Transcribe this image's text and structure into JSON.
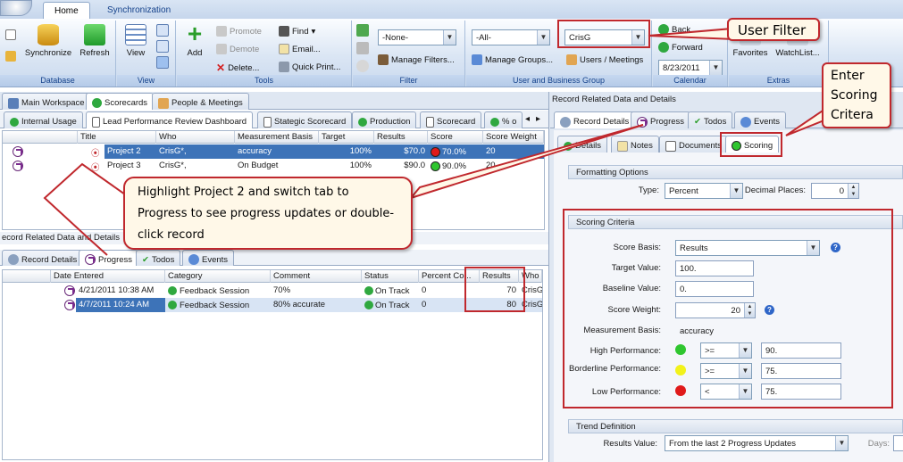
{
  "ribbon_tabs": [
    {
      "label": "Home"
    },
    {
      "label": "Synchronization"
    }
  ],
  "ribbon": {
    "database": {
      "label": "Database",
      "synchronize": "Synchronize",
      "refresh": "Refresh"
    },
    "view": {
      "label": "View",
      "view": "View"
    },
    "tools": {
      "label": "Tools",
      "add": "Add",
      "promote": "Promote",
      "demote": "Demote",
      "delete": "Delete...",
      "find": "Find",
      "email": "Email...",
      "quick_print": "Quick Print..."
    },
    "filter": {
      "label": "Filter",
      "combo": "-None-",
      "manage": "Manage Filters..."
    },
    "ubg": {
      "label": "User and Business Group",
      "combo": "-All-",
      "manage_groups": "Manage Groups...",
      "user_combo": "CrisG",
      "users_meetings": "Users / Meetings"
    },
    "calendar": {
      "label": "Calendar",
      "back": "Back",
      "forward": "Forward",
      "date": "8/23/2011"
    },
    "extras": {
      "label": "Extras",
      "favorites": "Favorites",
      "watchlist": "WatchList..."
    }
  },
  "workspace_tabs": [
    {
      "label": "Main Workspace"
    },
    {
      "label": "Scorecards"
    },
    {
      "label": "People & Meetings"
    }
  ],
  "scorecard_tabs": [
    {
      "label": "Internal Usage"
    },
    {
      "label": "Lead Performance Review Dashboard"
    },
    {
      "label": "Stategic Scorecard"
    },
    {
      "label": "Production"
    },
    {
      "label": "Scorecard"
    },
    {
      "label": "% o"
    }
  ],
  "scorecard_grid": {
    "headers": [
      "Title",
      "Who",
      "Measurement Basis",
      "Target",
      "Results",
      "Score",
      "Score Weight"
    ],
    "rows": [
      {
        "title": "Project 2",
        "who": "CrisG*,",
        "basis": "accuracy",
        "target": "100%",
        "results": "$70.0",
        "score": "70.0%",
        "weight": "20"
      },
      {
        "title": "Project 3",
        "who": "CrisG*,",
        "basis": "On Budget",
        "target": "100%",
        "results": "$90.0",
        "score": "90.0%",
        "weight": "20"
      }
    ]
  },
  "lower_panel_title": "ecord Related Data and Details",
  "lower_tabs": [
    {
      "label": "Record Details"
    },
    {
      "label": "Progress"
    },
    {
      "label": "Todos"
    },
    {
      "label": "Events"
    }
  ],
  "progress_grid": {
    "headers": [
      "Date Entered",
      "Category",
      "Comment",
      "Status",
      "Percent Co...",
      "Results",
      "Who Source"
    ],
    "rows": [
      {
        "date": "4/21/2011 10:38 AM",
        "category": "Feedback Session",
        "comment": "70%",
        "status": "On Track",
        "percent": "0",
        "results": "70",
        "who": "CrisG"
      },
      {
        "date": "4/7/2011 10:24 AM",
        "category": "Feedback Session",
        "comment": "80% accurate",
        "status": "On Track",
        "percent": "0",
        "results": "80",
        "who": "CrisG"
      }
    ]
  },
  "right_panel": {
    "title": "Record Related Data and Details",
    "tabs": [
      {
        "label": "Record Details"
      },
      {
        "label": "Progress"
      },
      {
        "label": "Todos"
      },
      {
        "label": "Events"
      }
    ],
    "subtabs": [
      {
        "label": "Details"
      },
      {
        "label": "Notes"
      },
      {
        "label": "Documents"
      },
      {
        "label": "Scoring"
      }
    ],
    "formatting": {
      "title": "Formatting Options",
      "type_label": "Type:",
      "type_value": "Percent",
      "decimal_label": "Decimal Places:",
      "decimal_value": "0"
    },
    "scoring": {
      "title": "Scoring Criteria",
      "score_basis_label": "Score Basis:",
      "score_basis": "Results",
      "target_label": "Target Value:",
      "target": "100.",
      "baseline_label": "Baseline Value:",
      "baseline": "0.",
      "weight_label": "Score Weight:",
      "weight": "20",
      "basis_label": "Measurement Basis:",
      "basis": "accuracy",
      "high_label": "High Performance:",
      "high_op": ">=",
      "high_val": "90.",
      "border_label": "Borderline Performance:",
      "border_op": ">=",
      "border_val": "75.",
      "low_label": "Low Performance:",
      "low_op": "<",
      "low_val": "75."
    },
    "trend": {
      "title": "Trend Definition",
      "results_label": "Results Value:",
      "results_value": "From the last 2 Progress Updates",
      "days_label": "Days:"
    }
  },
  "callouts": {
    "user_filter": "User Filter",
    "enter_scoring": "Enter Scoring Critera",
    "highlight": "Highlight Project 2 and switch tab to Progress to see progress updates or double-click record"
  },
  "colors": {
    "accent": "#c0282d",
    "selection": "#3d73b8",
    "green": "#2fc62f",
    "yellow": "#f2f21a",
    "red": "#e01a1a"
  }
}
